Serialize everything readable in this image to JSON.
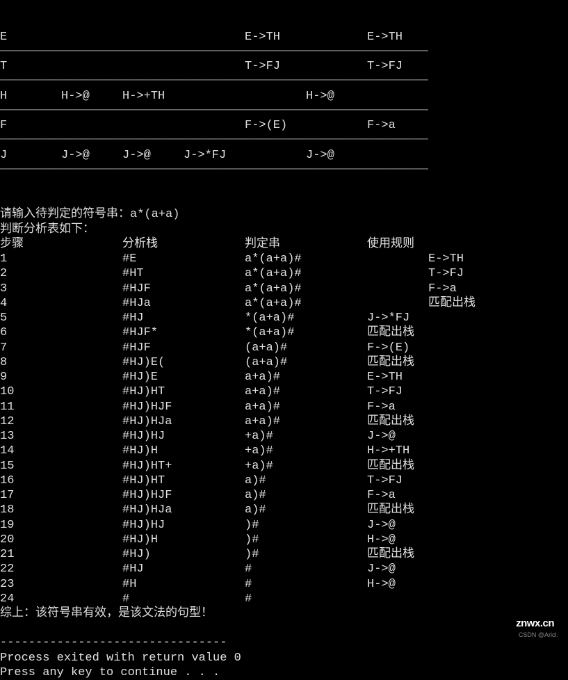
{
  "grammar": {
    "divider": "─────────────────────────────────────────────────────────────",
    "rows": [
      {
        "c1": "E",
        "c2": "",
        "c3": "",
        "c4": "",
        "c5": "E->TH",
        "c6": "",
        "c7": "E->TH"
      },
      {
        "c1": "T",
        "c2": "",
        "c3": "",
        "c4": "",
        "c5": "T->FJ",
        "c6": "",
        "c7": "T->FJ"
      },
      {
        "c1": "H",
        "c2": "H->@",
        "c3": "H->+TH",
        "c4": "",
        "c5": "",
        "c6": "H->@",
        "c7": ""
      },
      {
        "c1": "F",
        "c2": "",
        "c3": "",
        "c4": "",
        "c5": "F->(E)",
        "c6": "",
        "c7": "F->a"
      },
      {
        "c1": "J",
        "c2": "J->@",
        "c3": "J->@",
        "c4": "J->*FJ",
        "c5": "",
        "c6": "J->@",
        "c7": ""
      }
    ]
  },
  "prompt": "请输入待判定的符号串：a*(a+a)",
  "analysis_header": "判断分析表如下：",
  "table": {
    "headers": {
      "step": "步骤",
      "stack": "分析栈",
      "input": "判定串",
      "rule": "使用规则"
    },
    "rows": [
      {
        "step": "1",
        "stack": "#E",
        "input": "a*(a+a)#",
        "rule": "E->TH",
        "wide": true
      },
      {
        "step": "2",
        "stack": "#HT",
        "input": "a*(a+a)#",
        "rule": "T->FJ",
        "wide": true
      },
      {
        "step": "3",
        "stack": "#HJF",
        "input": "a*(a+a)#",
        "rule": "F->a",
        "wide": true
      },
      {
        "step": "4",
        "stack": "#HJa",
        "input": "a*(a+a)#",
        "rule": "匹配出栈",
        "wide": true
      },
      {
        "step": "5",
        "stack": "#HJ",
        "input": "*(a+a)#",
        "rule": "J->*FJ",
        "wide": false
      },
      {
        "step": "6",
        "stack": "#HJF*",
        "input": "*(a+a)#",
        "rule": "匹配出栈",
        "wide": false
      },
      {
        "step": "7",
        "stack": "#HJF",
        "input": "(a+a)#",
        "rule": "F->(E)",
        "wide": false
      },
      {
        "step": "8",
        "stack": "#HJ)E(",
        "input": "(a+a)#",
        "rule": "匹配出栈",
        "wide": false
      },
      {
        "step": "9",
        "stack": "#HJ)E",
        "input": "a+a)#",
        "rule": "E->TH",
        "wide": false
      },
      {
        "step": "10",
        "stack": "#HJ)HT",
        "input": "a+a)#",
        "rule": "T->FJ",
        "wide": false
      },
      {
        "step": "11",
        "stack": "#HJ)HJF",
        "input": "a+a)#",
        "rule": "F->a",
        "wide": false
      },
      {
        "step": "12",
        "stack": "#HJ)HJa",
        "input": "a+a)#",
        "rule": "匹配出栈",
        "wide": false
      },
      {
        "step": "13",
        "stack": "#HJ)HJ",
        "input": "+a)#",
        "rule": "J->@",
        "wide": false
      },
      {
        "step": "14",
        "stack": "#HJ)H",
        "input": "+a)#",
        "rule": "H->+TH",
        "wide": false
      },
      {
        "step": "15",
        "stack": "#HJ)HT+",
        "input": "+a)#",
        "rule": "匹配出栈",
        "wide": false
      },
      {
        "step": "16",
        "stack": "#HJ)HT",
        "input": "a)#",
        "rule": "T->FJ",
        "wide": false
      },
      {
        "step": "17",
        "stack": "#HJ)HJF",
        "input": "a)#",
        "rule": "F->a",
        "wide": false
      },
      {
        "step": "18",
        "stack": "#HJ)HJa",
        "input": "a)#",
        "rule": "匹配出栈",
        "wide": false
      },
      {
        "step": "19",
        "stack": "#HJ)HJ",
        "input": ")#",
        "rule": "J->@",
        "wide": false
      },
      {
        "step": "20",
        "stack": "#HJ)H",
        "input": ")#",
        "rule": "H->@",
        "wide": false
      },
      {
        "step": "21",
        "stack": "#HJ)",
        "input": ")#",
        "rule": "匹配出栈",
        "wide": false
      },
      {
        "step": "22",
        "stack": "#HJ",
        "input": "#",
        "rule": "J->@",
        "wide": false
      },
      {
        "step": "23",
        "stack": "#H",
        "input": "#",
        "rule": "H->@",
        "wide": false
      },
      {
        "step": "24",
        "stack": "#",
        "input": "#",
        "rule": "",
        "wide": false
      }
    ]
  },
  "conclusion": "综上：该符号串有效，是该文法的句型！",
  "dashes": "--------------------------------",
  "exit_msg": "Process exited with return value 0",
  "continue_msg": "Press any key to continue . . .",
  "watermark1": "znwx.cn",
  "watermark2": "CSDN @Aricl."
}
